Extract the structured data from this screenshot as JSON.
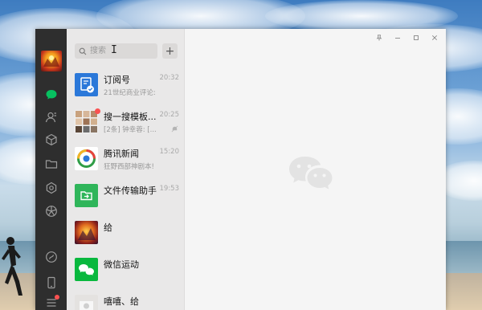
{
  "search": {
    "placeholder": "搜索"
  },
  "add_button": {
    "label": "+"
  },
  "chats": [
    {
      "name": "订阅号",
      "time": "20:32",
      "preview": "21世纪商业评论:",
      "icon": "subscription-icon",
      "color": "#2b78d9"
    },
    {
      "name": "搜一搜模板...",
      "time": "20:25",
      "preview": "[2条] 钟幸蓉: [...",
      "icon": "group-avatar",
      "muted": true,
      "unread": true
    },
    {
      "name": "腾讯新闻",
      "time": "15:20",
      "preview": "狂野西部神剧本!",
      "icon": "tencent-news-icon"
    },
    {
      "name": "文件传输助手",
      "time": "19:53",
      "preview": "",
      "icon": "file-transfer-icon",
      "color": "#2fb55a"
    },
    {
      "name": "给",
      "time": "",
      "preview": "",
      "icon": "game-avatar"
    },
    {
      "name": "微信运动",
      "time": "",
      "preview": "",
      "icon": "wechat-sport-icon",
      "color": "#09b83e"
    },
    {
      "name": "嘻嘻、给",
      "time": "",
      "preview": "",
      "icon": "user-avatar"
    }
  ],
  "sidebar": {
    "icons": [
      "chat-icon",
      "contacts-icon",
      "favorites-icon",
      "folder-icon",
      "mini-program-icon",
      "moments-icon",
      "channels-icon",
      "phone-icon",
      "menu-icon"
    ]
  },
  "colors": {
    "sidebar": "#2e2e2e",
    "list": "#e9e8e8",
    "accent": "#07c160",
    "badge": "#fa5151"
  }
}
